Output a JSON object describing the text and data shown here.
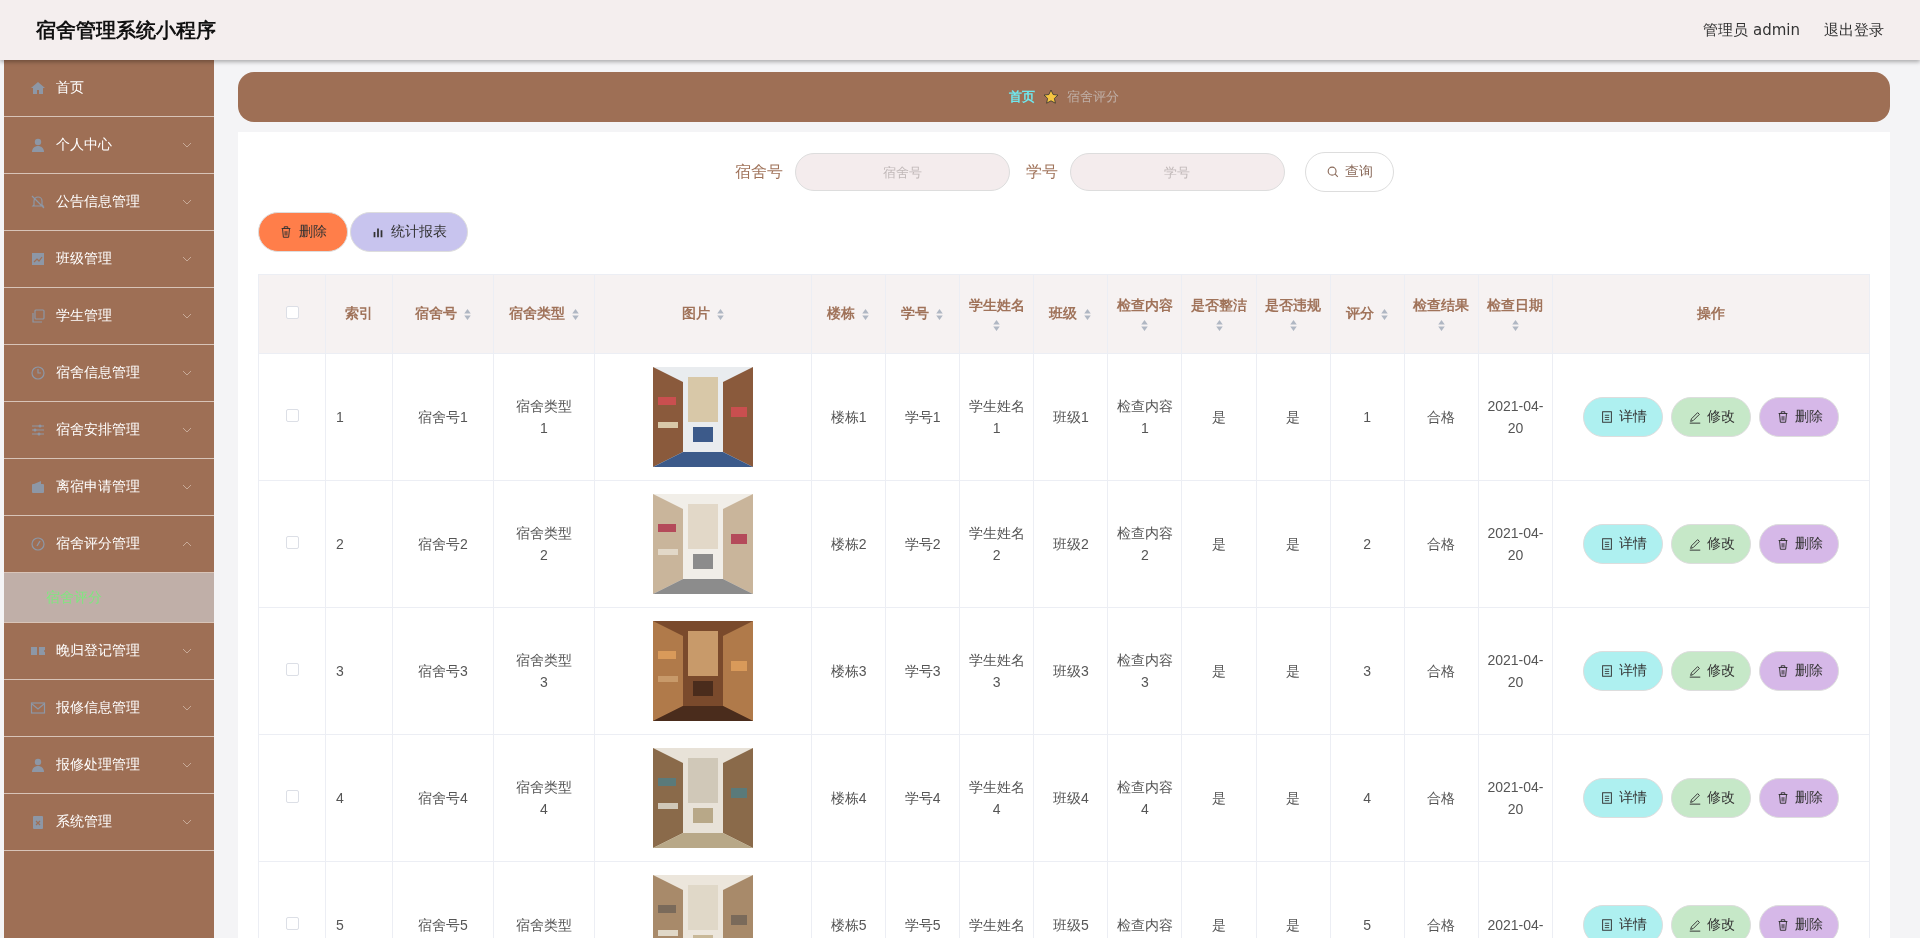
{
  "header": {
    "title": "宿舍管理系统小程序",
    "user": "管理员 admin",
    "logout": "退出登录"
  },
  "sidebar": {
    "items": [
      {
        "label": "首页",
        "kind": "link"
      },
      {
        "label": "个人中心",
        "kind": "group",
        "expanded": false
      },
      {
        "label": "公告信息管理",
        "kind": "group",
        "expanded": false
      },
      {
        "label": "班级管理",
        "kind": "group",
        "expanded": false
      },
      {
        "label": "学生管理",
        "kind": "group",
        "expanded": false
      },
      {
        "label": "宿舍信息管理",
        "kind": "group",
        "expanded": false
      },
      {
        "label": "宿舍安排管理",
        "kind": "group",
        "expanded": false
      },
      {
        "label": "离宿申请管理",
        "kind": "group",
        "expanded": false
      },
      {
        "label": "宿舍评分管理",
        "kind": "group",
        "expanded": true,
        "children": [
          {
            "label": "宿舍评分",
            "selected": true
          }
        ]
      },
      {
        "label": "晚归登记管理",
        "kind": "group",
        "expanded": false
      },
      {
        "label": "报修信息管理",
        "kind": "group",
        "expanded": false
      },
      {
        "label": "报修处理管理",
        "kind": "group",
        "expanded": false
      },
      {
        "label": "系统管理",
        "kind": "group",
        "expanded": false
      }
    ]
  },
  "breadcrumb": [
    "首页",
    "宿舍评分"
  ],
  "search": {
    "fields": [
      {
        "label": "宿舍号",
        "placeholder": "宿舍号"
      },
      {
        "label": "学号",
        "placeholder": "学号"
      }
    ],
    "button": "查询"
  },
  "actions": [
    {
      "label": "删除",
      "kind": "delete"
    },
    {
      "label": "统计报表",
      "kind": "report"
    }
  ],
  "table": {
    "all_checked": false,
    "columns": [
      {
        "label": "索引",
        "sortable": false
      },
      {
        "label": "宿舍号",
        "sortable": true
      },
      {
        "label": "宿舍类型",
        "sortable": true
      },
      {
        "label": "图片",
        "sortable": true
      },
      {
        "label": "楼栋",
        "sortable": true
      },
      {
        "label": "学号",
        "sortable": true
      },
      {
        "label": "学生姓名",
        "sortable": true
      },
      {
        "label": "班级",
        "sortable": true
      },
      {
        "label": "检查内容",
        "sortable": true
      },
      {
        "label": "是否整洁",
        "sortable": true
      },
      {
        "label": "是否违规",
        "sortable": true
      },
      {
        "label": "评分",
        "sortable": true
      },
      {
        "label": "检查结果",
        "sortable": true
      },
      {
        "label": "检查日期",
        "sortable": true
      },
      {
        "label": "操作",
        "sortable": false
      }
    ],
    "rows": [
      {
        "checked": false,
        "cells": [
          "1",
          "宿舍号1",
          "宿舍类型1",
          "",
          "楼栋1",
          "学号1",
          "学生姓名1",
          "班级1",
          "检查内容1",
          "是",
          "是",
          "1",
          "合格",
          "2021-04-20"
        ],
        "picture": {
          "kind": "picture"
        },
        "actions": [
          {
            "label": "详情",
            "kind": "detail"
          },
          {
            "label": "修改",
            "kind": "edit"
          },
          {
            "label": "删除",
            "kind": "delete"
          }
        ]
      },
      {
        "checked": false,
        "cells": [
          "2",
          "宿舍号2",
          "宿舍类型2",
          "",
          "楼栋2",
          "学号2",
          "学生姓名2",
          "班级2",
          "检查内容2",
          "是",
          "是",
          "2",
          "合格",
          "2021-04-20"
        ],
        "picture": {
          "kind": "picture"
        },
        "actions": [
          {
            "label": "详情",
            "kind": "detail"
          },
          {
            "label": "修改",
            "kind": "edit"
          },
          {
            "label": "删除",
            "kind": "delete"
          }
        ]
      },
      {
        "checked": false,
        "cells": [
          "3",
          "宿舍号3",
          "宿舍类型3",
          "",
          "楼栋3",
          "学号3",
          "学生姓名3",
          "班级3",
          "检查内容3",
          "是",
          "是",
          "3",
          "合格",
          "2021-04-20"
        ],
        "picture": {
          "kind": "picture"
        },
        "actions": [
          {
            "label": "详情",
            "kind": "detail"
          },
          {
            "label": "修改",
            "kind": "edit"
          },
          {
            "label": "删除",
            "kind": "delete"
          }
        ]
      },
      {
        "checked": false,
        "cells": [
          "4",
          "宿舍号4",
          "宿舍类型4",
          "",
          "楼栋4",
          "学号4",
          "学生姓名4",
          "班级4",
          "检查内容4",
          "是",
          "是",
          "4",
          "合格",
          "2021-04-20"
        ],
        "picture": {
          "kind": "picture"
        },
        "actions": [
          {
            "label": "详情",
            "kind": "detail"
          },
          {
            "label": "修改",
            "kind": "edit"
          },
          {
            "label": "删除",
            "kind": "delete"
          }
        ]
      },
      {
        "checked": false,
        "cells": [
          "5",
          "宿舍号5",
          "宿舍类型",
          "",
          "楼栋5",
          "学号5",
          "学生姓名",
          "班级5",
          "检查内容",
          "是",
          "是",
          "5",
          "合格",
          "2021-04-"
        ],
        "picture": {
          "kind": "picture"
        },
        "actions": [
          {
            "label": "详情",
            "kind": "detail"
          },
          {
            "label": "修改",
            "kind": "edit"
          },
          {
            "label": "删除",
            "kind": "delete"
          }
        ]
      }
    ]
  }
}
